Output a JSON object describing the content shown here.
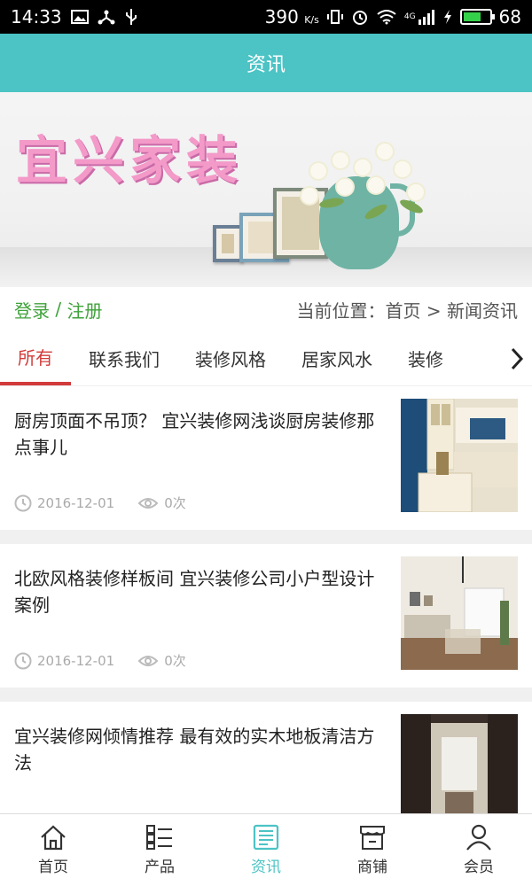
{
  "status_bar": {
    "time": "14:33",
    "speed": "390",
    "speed_unit": "K/s",
    "network": "4G",
    "battery": "68",
    "battery_level_pct": 68
  },
  "header": {
    "title": "资讯"
  },
  "banner": {
    "title": "宜兴家装"
  },
  "account": {
    "login": "登录",
    "separator": " / ",
    "register": "注册"
  },
  "breadcrumb": {
    "prefix": "当前位置：",
    "home": "首页",
    "arrow": " > ",
    "current": "新闻资讯"
  },
  "tabs": [
    {
      "label": "所有",
      "active": true
    },
    {
      "label": "联系我们"
    },
    {
      "label": "装修风格"
    },
    {
      "label": "居家风水"
    },
    {
      "label": "装修"
    }
  ],
  "news": [
    {
      "title": "厨房顶面不吊顶？ 宜兴装修网浅谈厨房装修那点事儿",
      "date": "2016-12-01",
      "views": "0次"
    },
    {
      "title": "北欧风格装修样板间 宜兴装修公司小户型设计案例",
      "date": "2016-12-01",
      "views": "0次"
    },
    {
      "title": "宜兴装修网倾情推荐 最有效的实木地板清洁方法",
      "date": "",
      "views": ""
    }
  ],
  "bottom_nav": [
    {
      "label": "首页",
      "icon": "home-icon"
    },
    {
      "label": "产品",
      "icon": "list-icon"
    },
    {
      "label": "资讯",
      "icon": "news-icon",
      "active": true
    },
    {
      "label": "商铺",
      "icon": "shop-icon"
    },
    {
      "label": "会员",
      "icon": "user-icon"
    }
  ],
  "colors": {
    "accent": "#4cc3c5",
    "active_tab": "#d23b3b",
    "link": "#3fa23a"
  }
}
